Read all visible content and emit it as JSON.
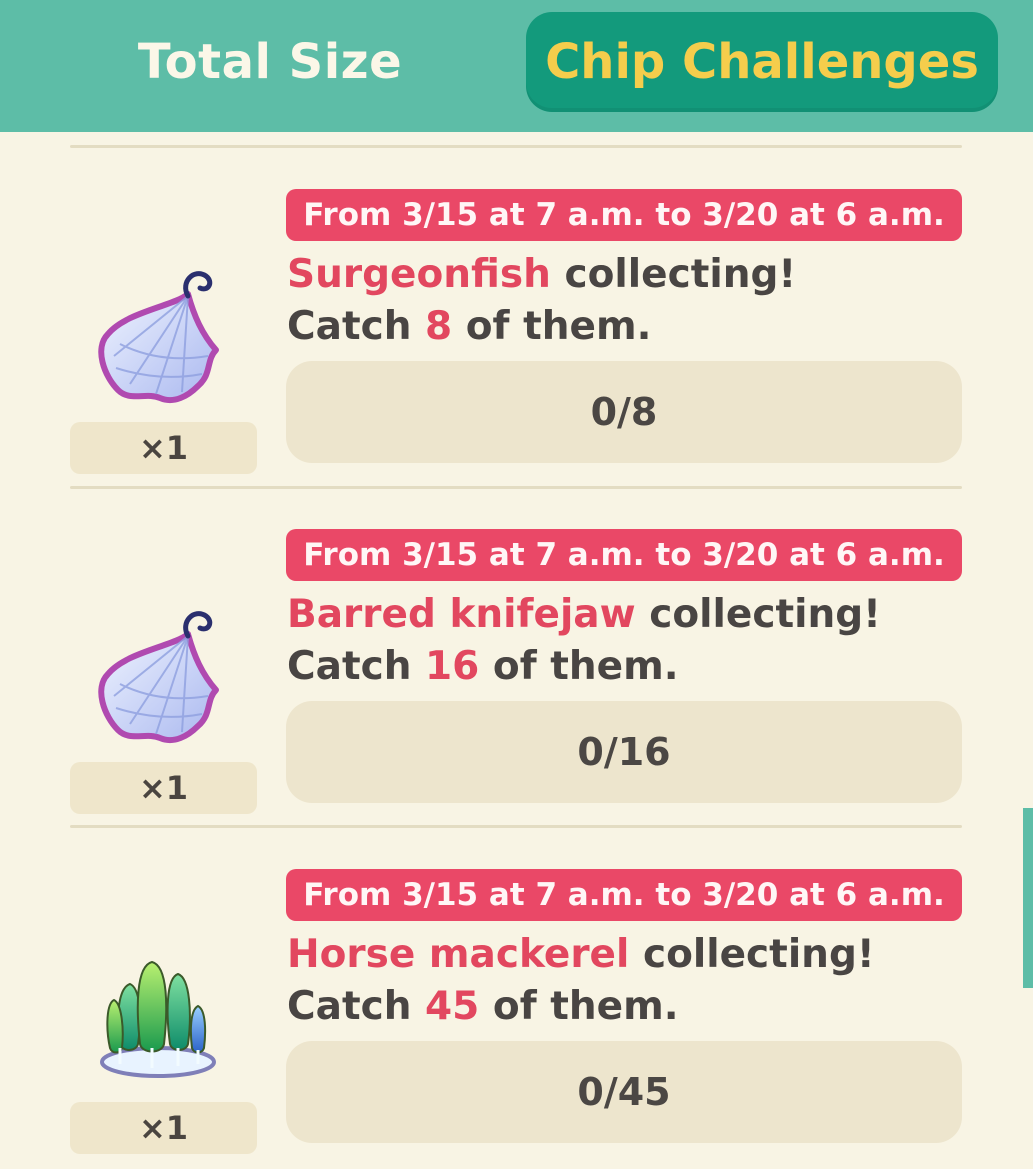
{
  "tabs": {
    "total_size": "Total Size",
    "chip_challenges": "Chip Challenges"
  },
  "colors": {
    "header": "#5dbda7",
    "active_tab": "#139a7c",
    "active_tab_text": "#f5cd4c",
    "period_badge": "#ea4867",
    "highlight": "#e2475f",
    "background": "#f8f4e4"
  },
  "challenges": [
    {
      "period": "From 3/15 at 7 a.m. to 3/20 at 6 a.m.",
      "fish": "Surgeonfish",
      "suffix": "collecting!",
      "catch_prefix": "Catch",
      "count": "8",
      "catch_suffix": "of them.",
      "progress": "0/8",
      "progress_fraction": 0,
      "reward_icon": "net-icon",
      "reward_qty": "×1"
    },
    {
      "period": "From 3/15 at 7 a.m. to 3/20 at 6 a.m.",
      "fish": "Barred knifejaw",
      "suffix": "collecting!",
      "catch_prefix": "Catch",
      "count": "16",
      "catch_suffix": "of them.",
      "progress": "0/16",
      "progress_fraction": 0,
      "reward_icon": "net-icon",
      "reward_qty": "×1"
    },
    {
      "period": "From 3/15 at 7 a.m. to 3/20 at 6 a.m.",
      "fish": "Horse mackerel",
      "suffix": "collecting!",
      "catch_prefix": "Catch",
      "count": "45",
      "catch_suffix": "of them.",
      "progress": "0/45",
      "progress_fraction": 0,
      "reward_icon": "tree-cluster-icon",
      "reward_qty": "×1"
    }
  ]
}
